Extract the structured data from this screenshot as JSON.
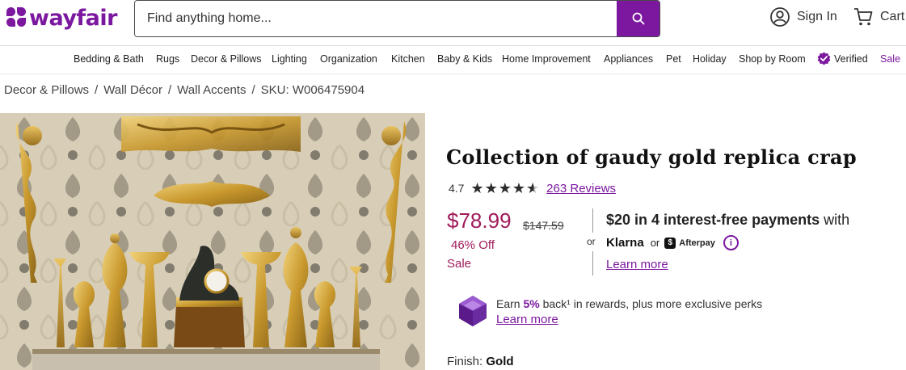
{
  "header": {
    "logo_text": "wayfair",
    "search_placeholder": "Find anything home...",
    "signin_label": "Sign In",
    "cart_label": "Cart"
  },
  "nav": {
    "items": [
      "Bedding & Bath",
      "Rugs",
      "Decor & Pillows",
      "Lighting",
      "Organization",
      "Kitchen",
      "Baby & Kids",
      "Home Improvement",
      "Appliances",
      "Pet",
      "Holiday",
      "Shop by Room",
      "Verified",
      "Sale"
    ]
  },
  "breadcrumb": {
    "items": [
      "Decor & Pillows",
      "Wall Décor",
      "Wall Accents",
      "SKU: W006475904"
    ],
    "separator": "/"
  },
  "product": {
    "title": "Collection of gaudy gold replica crap",
    "rating": "4.7",
    "reviews": "263 Reviews",
    "price": "$78.99",
    "list_price": "$147.59",
    "discount": "46% Off",
    "sale_label": "Sale",
    "or_label": "or",
    "installment_amount": "$20",
    "installment_text": " in 4 interest-free payments",
    "installment_suffix": " with",
    "klarna": "Klarna",
    "or_label_2": "or",
    "afterpay": "Afterpay",
    "learn_more": "Learn more",
    "rewards_prefix": "Earn ",
    "rewards_pct": "5%",
    "rewards_suffix": " back¹ in rewards, plus more exclusive perks",
    "rewards_link": "Learn more",
    "finish_label": "Finish:",
    "finish_value": "Gold"
  },
  "colors": {
    "brand": "#7b189f",
    "sale": "#a01b5a"
  }
}
